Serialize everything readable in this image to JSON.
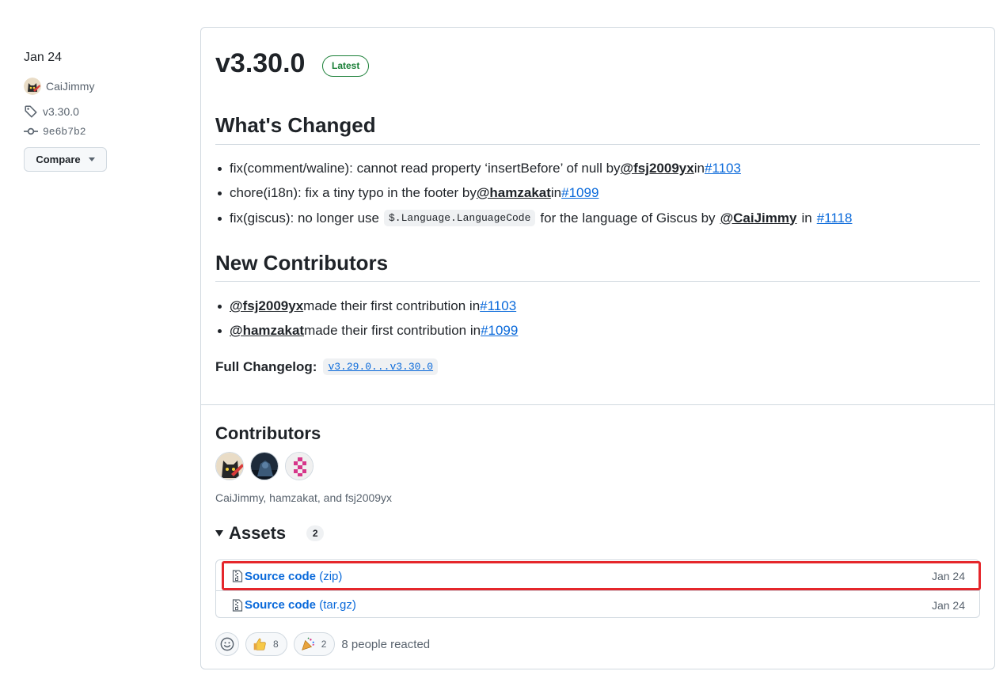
{
  "sidebar": {
    "date": "Jan 24",
    "author": "CaiJimmy",
    "tag": "v3.30.0",
    "commit": "9e6b7b2",
    "compare_label": "Compare"
  },
  "release": {
    "title": "v3.30.0",
    "badge": "Latest"
  },
  "whats_changed": {
    "heading": "What's Changed",
    "items": [
      {
        "text": "fix(comment/waline): cannot read property ‘insertBefore’ of null by",
        "author": "@fsj2009yx",
        "sep": "in",
        "pr": "#1103"
      },
      {
        "text": "chore(i18n): fix a tiny typo in the footer by",
        "author": "@hamzakat",
        "sep": "in",
        "pr": "#1099"
      },
      {
        "text_before": "fix(giscus): no longer use",
        "code": "$.Language.LanguageCode",
        "text_after": "for the language of Giscus by",
        "author": "@CaiJimmy",
        "sep": "in",
        "pr": "#1118"
      }
    ]
  },
  "new_contributors": {
    "heading": "New Contributors",
    "items": [
      {
        "author": "@fsj2009yx",
        "text": "made their first contribution in",
        "pr": "#1103"
      },
      {
        "author": "@hamzakat",
        "text": "made their first contribution in",
        "pr": "#1099"
      }
    ]
  },
  "changelog": {
    "label": "Full Changelog:",
    "range": "v3.29.0...v3.30.0"
  },
  "contributors": {
    "heading": "Contributors",
    "names": "CaiJimmy, hamzakat, and fsj2009yx"
  },
  "assets": {
    "heading": "Assets",
    "count": "2",
    "items": [
      {
        "name": "Source code",
        "ext": "(zip)",
        "date": "Jan 24"
      },
      {
        "name": "Source code",
        "ext": "(tar.gz)",
        "date": "Jan 24"
      }
    ]
  },
  "reactions": {
    "thumbs_up": "8",
    "party": "2",
    "summary": "8 people reacted"
  },
  "colors": {
    "link": "#0969da",
    "latest_badge": "#1a7f37",
    "highlight": "#e5262b",
    "border": "#d1d9e0"
  }
}
